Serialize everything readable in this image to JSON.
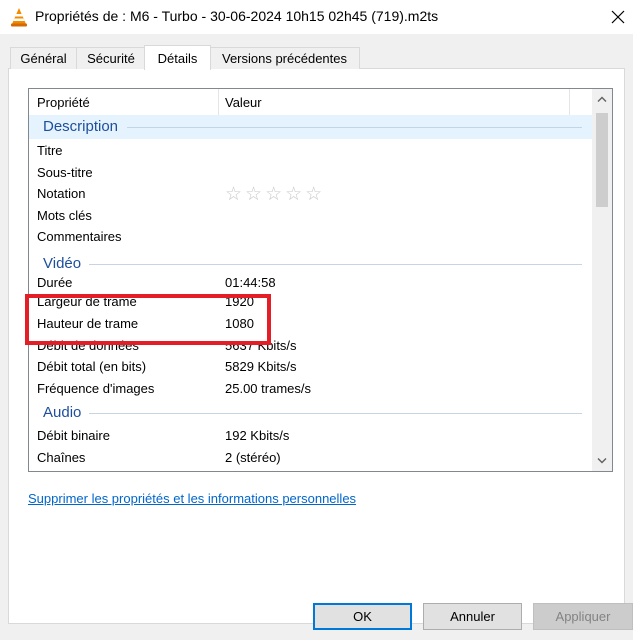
{
  "window": {
    "title": "Propriétés de : M6 - Turbo - 30-06-2024 10h15 02h45 (719).m2ts",
    "app_icon": "vlc-cone-icon",
    "close_icon": "close-icon"
  },
  "tabs": [
    {
      "label": "Général"
    },
    {
      "label": "Sécurité"
    },
    {
      "label": "Détails",
      "active": true
    },
    {
      "label": "Versions précédentes"
    }
  ],
  "list": {
    "col_property": "Propriété",
    "col_value": "Valeur",
    "groups": {
      "description": "Description",
      "video": "Vidéo",
      "audio": "Audio"
    },
    "rows": {
      "titre": {
        "prop": "Titre",
        "val": ""
      },
      "sous_titre": {
        "prop": "Sous-titre",
        "val": ""
      },
      "notation": {
        "prop": "Notation",
        "val": "☆☆☆☆☆"
      },
      "mots_cles": {
        "prop": "Mots clés",
        "val": ""
      },
      "commentaires": {
        "prop": "Commentaires",
        "val": ""
      },
      "duree": {
        "prop": "Durée",
        "val": "01:44:58"
      },
      "largeur": {
        "prop": "Largeur de trame",
        "val": "1920"
      },
      "hauteur": {
        "prop": "Hauteur de trame",
        "val": "1080"
      },
      "debit_donnees": {
        "prop": "Débit de données",
        "val": "5637 Kbits/s"
      },
      "debit_total": {
        "prop": "Débit total (en bits)",
        "val": "5829 Kbits/s"
      },
      "frequence": {
        "prop": "Fréquence d'images",
        "val": "25.00 trames/s"
      },
      "debit_binaire": {
        "prop": "Débit binaire",
        "val": "192 Kbits/s"
      },
      "chaines": {
        "prop": "Chaînes",
        "val": "2 (stéréo)"
      }
    }
  },
  "remove_link": "Supprimer les propriétés et les informations personnelles",
  "buttons": {
    "ok": "OK",
    "cancel": "Annuler",
    "apply": "Appliquer"
  },
  "colors": {
    "highlight": "#e41e26",
    "group_text": "#1e4e9c",
    "link": "#0066cc"
  }
}
